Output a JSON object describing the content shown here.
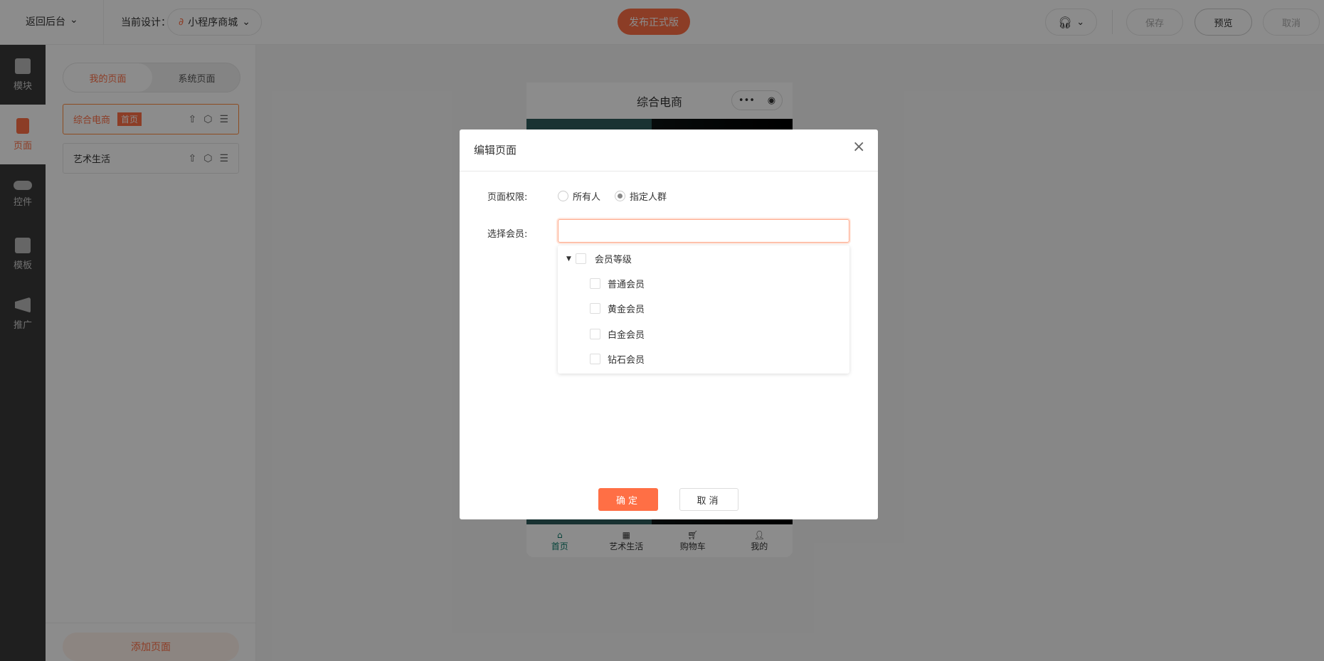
{
  "topbar": {
    "back": "返回后台",
    "current_label": "当前设计：",
    "current_design": "小程序商城",
    "publish": "发布正式版",
    "save": "保存",
    "preview": "预览",
    "cancel": "取消"
  },
  "rail": [
    {
      "label": "模块"
    },
    {
      "label": "页面"
    },
    {
      "label": "控件"
    },
    {
      "label": "模板"
    },
    {
      "label": "推广"
    }
  ],
  "panel": {
    "tabs": [
      "我的页面",
      "系统页面"
    ],
    "pages": [
      {
        "name": "综合电商",
        "badge": "首页"
      },
      {
        "name": "艺术生活"
      }
    ],
    "add": "添加页面"
  },
  "phone": {
    "title": "综合电商",
    "tabs": [
      "首页",
      "艺术生活",
      "购物车",
      "我的"
    ]
  },
  "modal": {
    "title": "编辑页面",
    "perm_label": "页面权限:",
    "perm_options": [
      "所有人",
      "指定人群"
    ],
    "member_label": "选择会员:",
    "member_value": "",
    "tree_root": "会员等级",
    "tree_children": [
      "普通会员",
      "黄金会员",
      "白金会员",
      "钻石会员"
    ],
    "ok": "确定",
    "cancel": "取消"
  },
  "colors": {
    "accent": "#ff6f45",
    "phone_active": "#0a7a6a"
  }
}
